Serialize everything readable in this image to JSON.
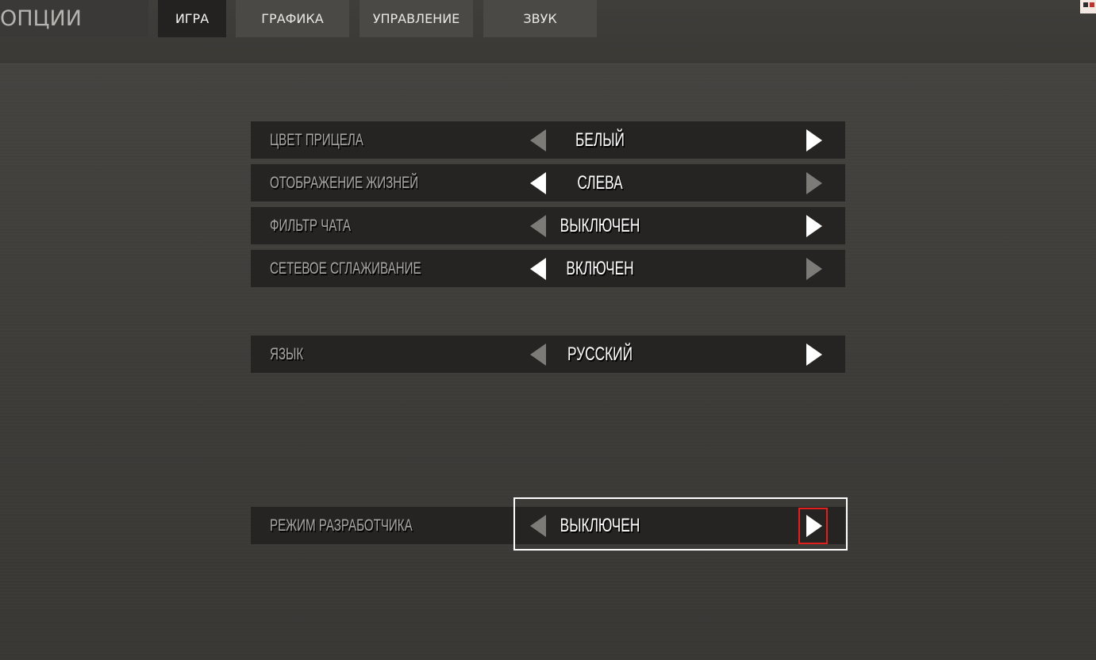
{
  "header": {
    "title": "ОПЦИИ",
    "tabs": [
      {
        "label": "ИГРА",
        "active": true
      },
      {
        "label": "ГРАФИКА",
        "active": false
      },
      {
        "label": "УПРАВЛЕНИЕ",
        "active": false
      },
      {
        "label": "ЗВУК",
        "active": false
      }
    ]
  },
  "settings": [
    {
      "label": "ЦВЕТ ПРИЦЕЛА",
      "value": "БЕЛЫЙ",
      "left_enabled": false,
      "right_enabled": true
    },
    {
      "label": "ОТОБРАЖЕНИЕ ЖИЗНЕЙ",
      "value": "СЛЕВА",
      "left_enabled": true,
      "right_enabled": false
    },
    {
      "label": "ФИЛЬТР ЧАТА",
      "value": "ВЫКЛЮЧЕН",
      "left_enabled": false,
      "right_enabled": true
    },
    {
      "label": "СЕТЕВОЕ СГЛАЖИВАНИЕ",
      "value": "ВКЛЮЧЕН",
      "left_enabled": true,
      "right_enabled": false
    },
    {
      "label": "ЯЗЫК",
      "value": "РУССКИЙ",
      "left_enabled": false,
      "right_enabled": true
    },
    {
      "label": "РЕЖИМ РАЗРАБОТЧИКА",
      "value": "ВЫКЛЮЧЕН",
      "left_enabled": false,
      "right_enabled": true
    }
  ],
  "icons": {
    "left_arrow": "triangle-left-icon",
    "right_arrow": "triangle-right-icon"
  },
  "colors": {
    "active_arrow": "#ffffff",
    "inactive_arrow": "#7d7b78",
    "focus_outline": "#ffffff",
    "cursor_highlight": "#e0201f"
  }
}
